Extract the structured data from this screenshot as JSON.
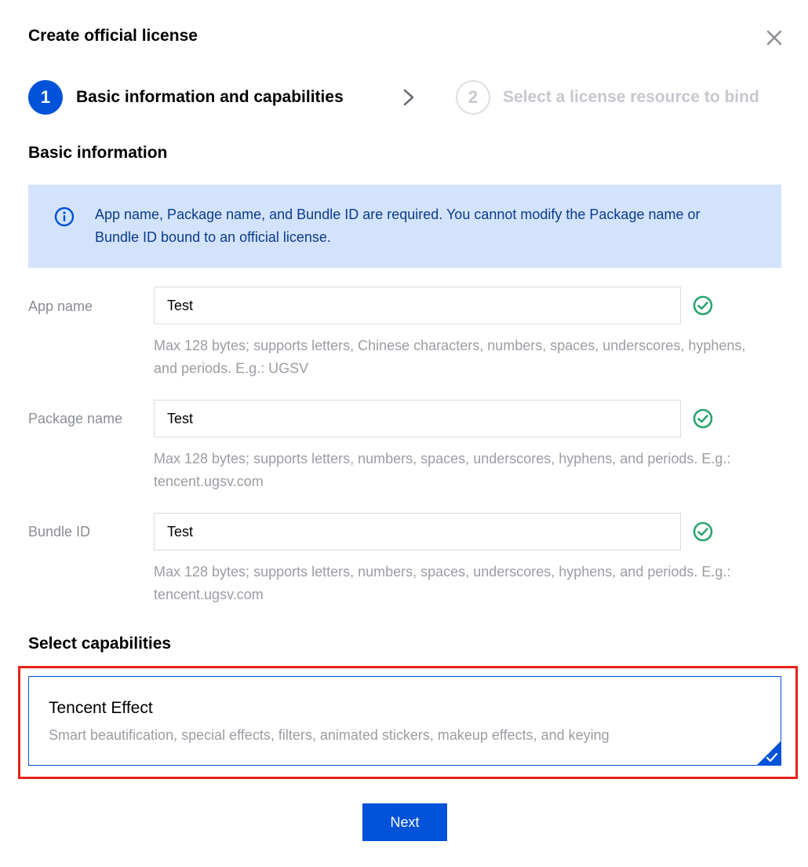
{
  "dialog": {
    "title": "Create official license"
  },
  "steps": [
    {
      "number": "1",
      "label": "Basic information and capabilities",
      "state": "active"
    },
    {
      "number": "2",
      "label": "Select a license resource to bind",
      "state": "inactive"
    }
  ],
  "basic_info": {
    "section_title": "Basic information",
    "notice_text": "App name, Package name, and Bundle ID are required. You cannot modify the Package name or Bundle ID bound to an official license.",
    "fields": [
      {
        "label": "App name",
        "value": "Test",
        "help": "Max 128 bytes; supports letters, Chinese characters, numbers, spaces, underscores, hyphens, and periods. E.g.: UGSV",
        "valid": true
      },
      {
        "label": "Package name",
        "value": "Test",
        "help": "Max 128 bytes; supports letters, numbers, spaces, underscores, hyphens, and periods. E.g.: tencent.ugsv.com",
        "valid": true
      },
      {
        "label": "Bundle ID",
        "value": "Test",
        "help": "Max 128 bytes; supports letters, numbers, spaces, underscores, hyphens, and periods. E.g.: tencent.ugsv.com",
        "valid": true
      }
    ]
  },
  "capabilities": {
    "section_title": "Select capabilities",
    "items": [
      {
        "title": "Tencent Effect",
        "description": "Smart beautification, special effects, filters, animated stickers, makeup effects, and keying",
        "selected": true
      }
    ]
  },
  "footer": {
    "next_label": "Next"
  },
  "colors": {
    "primary": "#0052d9",
    "success": "#2ba471",
    "notice_bg": "#d4e3fc",
    "highlight": "#e8201c"
  },
  "icons": {
    "close": "close-icon",
    "step_arrow": "chevron-right-icon",
    "notice": "info-icon",
    "valid": "check-circle-icon",
    "selected_corner": "checkmark-corner-icon"
  }
}
